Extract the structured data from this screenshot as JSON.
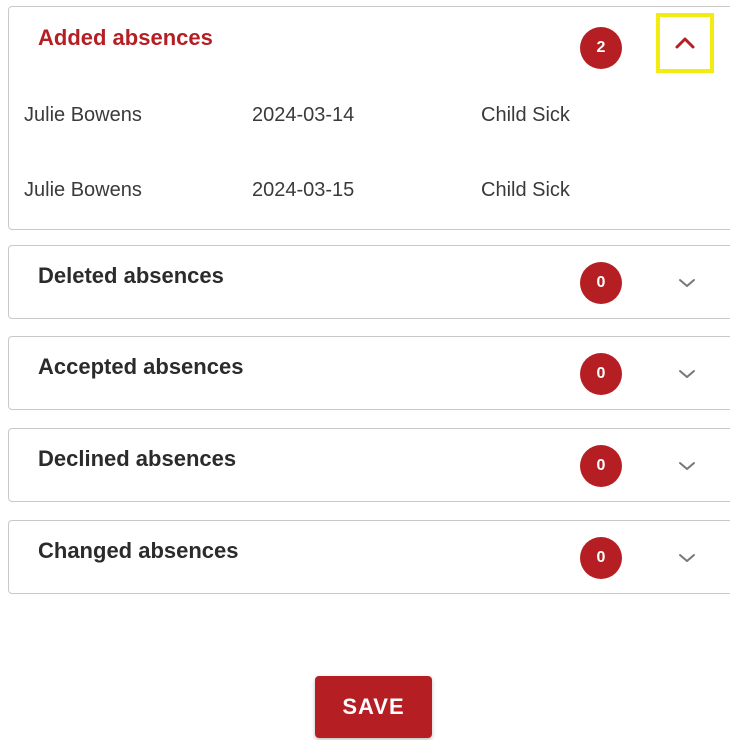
{
  "sections": {
    "added": {
      "title": "Added absences",
      "count": "2",
      "expanded": true,
      "rows": [
        {
          "name": "Julie Bowens",
          "date": "2024-03-14",
          "reason": "Child Sick"
        },
        {
          "name": "Julie Bowens",
          "date": "2024-03-15",
          "reason": "Child Sick"
        }
      ]
    },
    "deleted": {
      "title": "Deleted absences",
      "count": "0",
      "expanded": false
    },
    "accepted": {
      "title": "Accepted absences",
      "count": "0",
      "expanded": false
    },
    "declined": {
      "title": "Declined absences",
      "count": "0",
      "expanded": false
    },
    "changed": {
      "title": "Changed absences",
      "count": "0",
      "expanded": false
    }
  },
  "save_label": "SAVE",
  "icons": {
    "expanded": "chevron-up-icon",
    "collapsed": "chevron-down-icon"
  },
  "colors": {
    "accent": "#b51f24",
    "highlight": "#f2ec12",
    "border": "#c9c9c9"
  }
}
